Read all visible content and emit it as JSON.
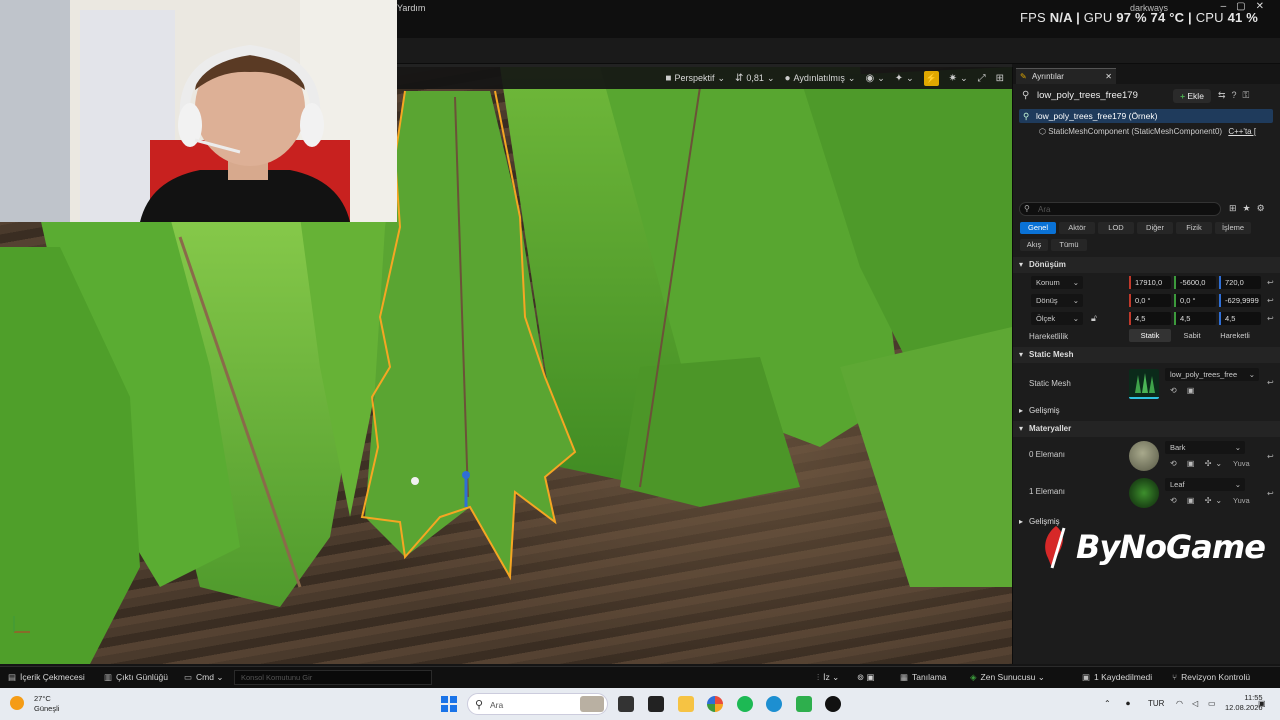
{
  "titlebar": {
    "menu_partial": "Yardım",
    "user": "darkways",
    "fps_label": "FPS",
    "fps_value": "N/A",
    "gpu_label": "GPU",
    "gpu_value": "97 %  74 °C",
    "cpu_label": "CPU",
    "cpu_value": "41 %"
  },
  "viewport": {
    "perspective": "Perspektif",
    "camera_speed": "0,81",
    "lit_mode": "Aydınlatılmış"
  },
  "details": {
    "tab_title": "Ayrıntılar",
    "actor_name": "low_poly_trees_free179",
    "add_label": "Ekle",
    "selected_item": "low_poly_trees_free179 (Örnek)",
    "component_item": "StaticMeshComponent (StaticMeshComponent0)",
    "component_link": "C++'ta [",
    "search_placeholder": "Ara",
    "categories_row1": [
      "Genel",
      "Aktör",
      "LOD",
      "Diğer",
      "Fizik",
      "İşleme"
    ],
    "categories_row2": [
      "Akış",
      "Tümü"
    ],
    "transform_section": "Dönüşüm",
    "location_label": "Konum",
    "location_values": [
      "17910,0",
      "-5600,0",
      "720,0"
    ],
    "rotation_label": "Dönüş",
    "rotation_values": [
      "0,0 °",
      "0,0 °",
      "-629,9999"
    ],
    "scale_label": "Ölçek",
    "scale_values": [
      "4,5",
      "4,5",
      "4,5"
    ],
    "mobility_label": "Hareketlilik",
    "mobility_options": [
      "Statik",
      "Sabit",
      "Hareketli"
    ],
    "static_mesh_section": "Static Mesh",
    "static_mesh_label": "Static Mesh",
    "static_mesh_value": "low_poly_trees_free",
    "advanced_label": "Gelişmiş",
    "materials_section": "Materyaller",
    "element0_label": "0 Elemanı",
    "element0_value": "Bark",
    "element1_label": "1 Elemanı",
    "element1_value": "Leaf",
    "slot_label": "Yuva",
    "advanced_label2": "Gelişmiş"
  },
  "watermark": "ByNoGame",
  "bottombar": {
    "content_drawer": "İçerik Çekmecesi",
    "output_log": "Çıktı Günlüğü",
    "cmd": "Cmd",
    "console_placeholder": "Konsol Komutunu Gir",
    "trace": "İz",
    "diagnostics": "Tanılama",
    "zen": "Zen Sunucusu",
    "unsaved": "1 Kaydedilmedi",
    "revision": "Revizyon Kontrolü"
  },
  "taskbar": {
    "temp": "27°C",
    "weather": "Güneşli",
    "search_placeholder": "Ara",
    "lang": "TUR",
    "time": "11:55",
    "date": "12.08.2026"
  },
  "colors": {
    "accent": "#e0a800",
    "selection": "#1f3b5c",
    "active_tab": "#0a72d6",
    "x_axis": "#c0392b",
    "y_axis": "#3c9a3c",
    "z_axis": "#2f6fd6"
  }
}
